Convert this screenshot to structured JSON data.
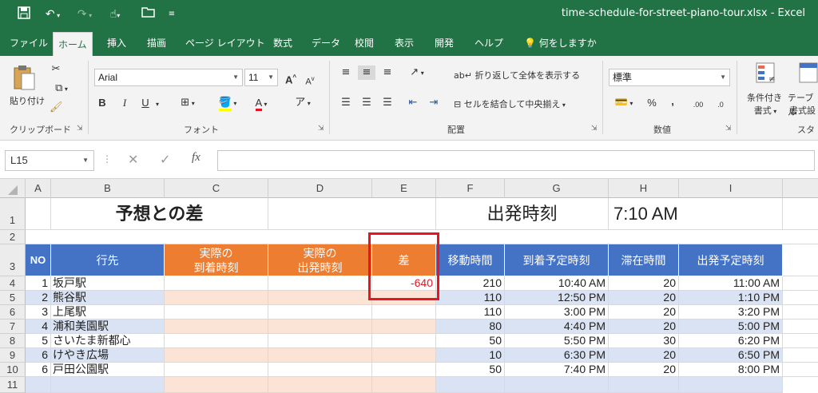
{
  "titlebar": {
    "doc_title": "time-schedule-for-street-piano-tour.xlsx  -  Excel",
    "qat": [
      "save-icon",
      "undo-icon",
      "redo-icon",
      "touch-mode-icon",
      "open-icon",
      "customize-icon"
    ]
  },
  "tabs": [
    "ファイル",
    "ホーム",
    "挿入",
    "描画",
    "ページ レイアウト",
    "数式",
    "データ",
    "校閲",
    "表示",
    "開発",
    "ヘルプ",
    "何をしますか"
  ],
  "ribbon": {
    "clipboard": {
      "paste": "貼り付け",
      "label": "クリップボード"
    },
    "font": {
      "name": "Arial",
      "size": "11",
      "bold": "B",
      "italic": "I",
      "underline": "U",
      "grow": "A",
      "shrink": "A",
      "label": "フォント"
    },
    "alignment": {
      "wrap": "折り返して全体を表示する",
      "merge": "セルを結合して中央揃え",
      "label": "配置"
    },
    "number": {
      "format": "標準",
      "percent": "%",
      "comma": ",",
      "inc_dec": ".00",
      "dec_dec": ".0",
      "label": "数値"
    },
    "styles": {
      "cond": "条件付き",
      "cond2": "書式",
      "table": "テーブル",
      "table2": "書式設",
      "label": "スタ"
    }
  },
  "formula_bar": {
    "name_box": "L15",
    "value": ""
  },
  "columns": [
    "A",
    "B",
    "C",
    "D",
    "E",
    "F",
    "G",
    "H",
    "I"
  ],
  "rows": [
    "1",
    "2",
    "3",
    "4",
    "5",
    "6",
    "7",
    "8",
    "9",
    "10",
    "11"
  ],
  "sheet": {
    "title_left": "予想との差",
    "title_right": "出発時刻",
    "start_time": "7:10 AM",
    "headers": {
      "no": "NO",
      "dest": "行先",
      "actual_arrive_1": "実際の",
      "actual_arrive_2": "到着時刻",
      "actual_depart_1": "実際の",
      "actual_depart_2": "出発時刻",
      "diff": "差",
      "travel": "移動時間",
      "planned_arrive": "到着予定時刻",
      "stay": "滞在時間",
      "planned_depart": "出発予定時刻"
    },
    "data": [
      {
        "no": "1",
        "dest": "坂戸駅",
        "diff": "-640",
        "travel": "210",
        "arrive": "10:40 AM",
        "stay": "20",
        "depart": "11:00 AM"
      },
      {
        "no": "2",
        "dest": "熊谷駅",
        "diff": "",
        "travel": "110",
        "arrive": "12:50 PM",
        "stay": "20",
        "depart": "1:10 PM"
      },
      {
        "no": "3",
        "dest": "上尾駅",
        "diff": "",
        "travel": "110",
        "arrive": "3:00 PM",
        "stay": "20",
        "depart": "3:20 PM"
      },
      {
        "no": "4",
        "dest": "浦和美園駅",
        "diff": "",
        "travel": "80",
        "arrive": "4:40 PM",
        "stay": "20",
        "depart": "5:00 PM"
      },
      {
        "no": "5",
        "dest": "さいたま新都心",
        "diff": "",
        "travel": "50",
        "arrive": "5:50 PM",
        "stay": "30",
        "depart": "6:20 PM"
      },
      {
        "no": "6",
        "dest": "けやき広場",
        "diff": "",
        "travel": "10",
        "arrive": "6:30 PM",
        "stay": "20",
        "depart": "6:50 PM"
      },
      {
        "no": "6",
        "dest": "戸田公園駅",
        "diff": "",
        "travel": "50",
        "arrive": "7:40 PM",
        "stay": "20",
        "depart": "8:00 PM"
      }
    ]
  },
  "colors": {
    "excel_green": "#217346",
    "header_blue": "#4472c4",
    "header_orange": "#ed7d31",
    "band_blue": "#dae3f3",
    "peach": "#fbe4d5",
    "diff_red": "#e8141e"
  }
}
